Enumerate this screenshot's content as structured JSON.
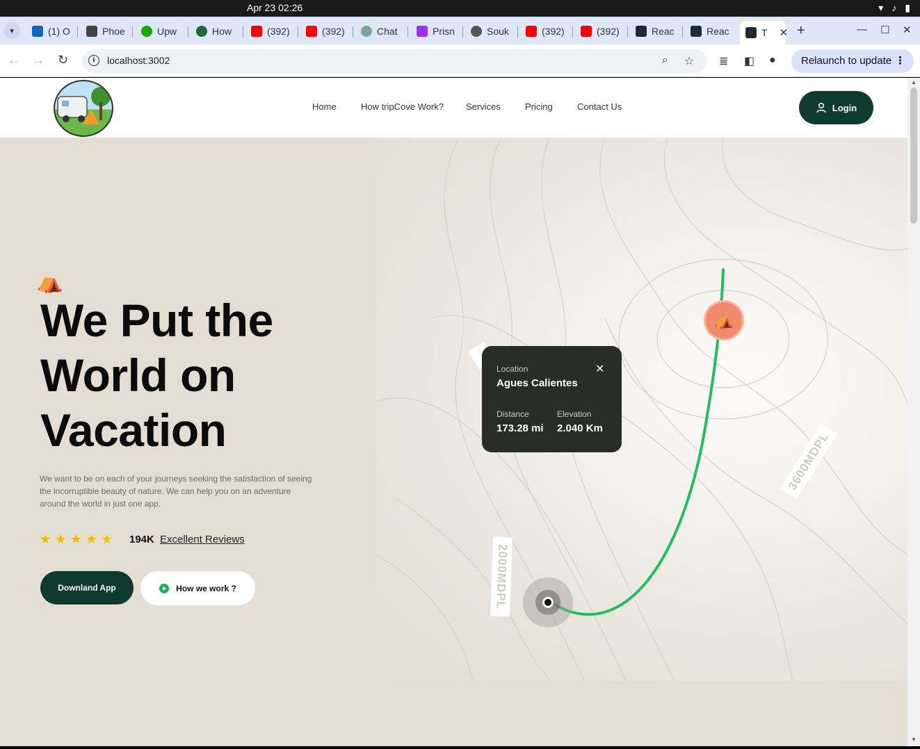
{
  "os": {
    "clock": "Apr 23  02:26"
  },
  "tabs": [
    {
      "label": "(1) O",
      "color": "#0a66c2"
    },
    {
      "label": "Phoe",
      "color": "#444444"
    },
    {
      "label": "Upw",
      "color": "#14a800"
    },
    {
      "label": "How",
      "color": "#1a6b3a"
    },
    {
      "label": "(392)",
      "color": "#ff0000"
    },
    {
      "label": "(392)",
      "color": "#ff0000"
    },
    {
      "label": "Chat",
      "color": "#74aa9c"
    },
    {
      "label": "Prisn",
      "color": "#9b30ff"
    },
    {
      "label": "Souk",
      "color": "#555555"
    },
    {
      "label": "(392)",
      "color": "#ff0000"
    },
    {
      "label": "(392)",
      "color": "#ff0000"
    },
    {
      "label": "Reac",
      "color": "#1b2a36"
    },
    {
      "label": "Reac",
      "color": "#1b2a36"
    },
    {
      "label": "T",
      "color": "#1b2a36"
    }
  ],
  "browser": {
    "url": "localhost:3002",
    "relaunch_label": "Relaunch to update"
  },
  "site": {
    "nav": [
      "Home",
      "How tripCove Work?",
      "Services",
      "Pricing",
      "Contact Us"
    ],
    "login_label": "Login"
  },
  "hero": {
    "title_lines": [
      "We Put the",
      "World on",
      "Vacation"
    ],
    "description": "We want to be on each of your journeys seeking the satisfaction of seeing the incorruptible beauty of nature. We can help you on an adventure around the world in just one app.",
    "rating_stars": 5,
    "review_count": "194K",
    "review_link": "Excellent Reviews",
    "download_label": "Downland App",
    "how_label": "How we work ?"
  },
  "map": {
    "card": {
      "location_label": "Location",
      "location_value": "Agues Calientes",
      "distance_label": "Distance",
      "distance_value": "173.28 mi",
      "elevation_label": "Elevation",
      "elevation_value": "2.040 Km"
    },
    "tag_low": "2000MDPL",
    "tag_high": "3600MDPL",
    "route_color": "#1fbf62",
    "pin_color": "#f08a6a"
  }
}
